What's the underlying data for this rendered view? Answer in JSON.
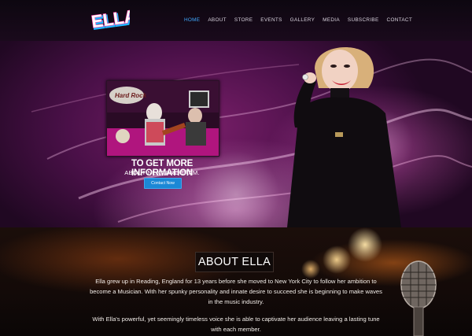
{
  "brand": {
    "logo_text": "ELLA"
  },
  "nav": {
    "items": [
      {
        "label": "HOME",
        "active": true
      },
      {
        "label": "ABOUT",
        "active": false
      },
      {
        "label": "STORE",
        "active": false
      },
      {
        "label": "EVENTS",
        "active": false
      },
      {
        "label": "GALLERY",
        "active": false
      },
      {
        "label": "MEDIA",
        "active": false
      },
      {
        "label": "SUBSCRIBE",
        "active": false
      },
      {
        "label": "CONTACT",
        "active": false
      }
    ]
  },
  "hero": {
    "promo_title": "TO GET MORE INFORMATION",
    "promo_subtitle": "ABOUT NEXT PROGRAM.",
    "cta_label": "Contact Now",
    "photo_sign_text": "Hard Rock"
  },
  "about": {
    "title": "ABOUT ELLA",
    "paragraph_1_line_1": "Ella grew up in Reading, England for 13 years before she moved to New York City to follow her ambition to",
    "paragraph_1_line_2": "become a Musician. With her spunky personality and innate desire to succeed she is beginning to make waves",
    "paragraph_1_line_3": "in the music industry.",
    "paragraph_2_line_1": "With Ella's powerful, yet seemingly timeless voice she is able to captivate her audience leaving a lasting tune",
    "paragraph_2_line_2": "with each member."
  },
  "colors": {
    "accent": "#3fa9ff",
    "button": "#1b88d6",
    "hero_purple": "#6a1a5e"
  },
  "icons": {
    "logo": "ella-logo-icon",
    "microphone": "microphone-icon"
  }
}
